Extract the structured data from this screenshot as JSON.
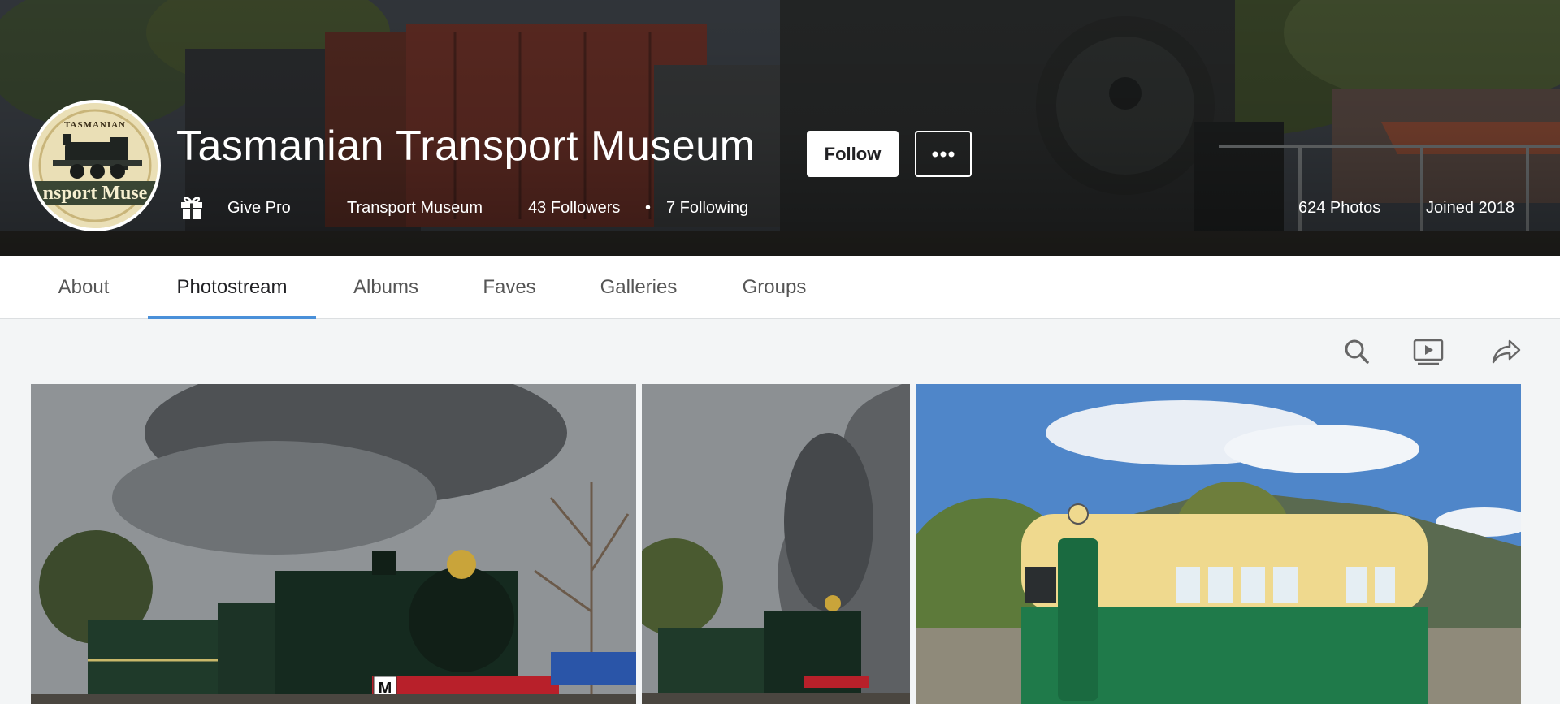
{
  "profile": {
    "name": "Tasmanian Transport Museum",
    "follow_label": "Follow",
    "give_pro_label": "Give Pro",
    "account_type": "Transport Museum",
    "followers": "43 Followers",
    "following": "7 Following",
    "photos": "624 Photos",
    "joined": "Joined 2018",
    "avatar": {
      "arc_text": "TASMANIAN",
      "banner_text": "nsport Muse"
    }
  },
  "tabs": [
    {
      "label": "About",
      "active": false
    },
    {
      "label": "Photostream",
      "active": true
    },
    {
      "label": "Albums",
      "active": false
    },
    {
      "label": "Faves",
      "active": false
    },
    {
      "label": "Galleries",
      "active": false
    },
    {
      "label": "Groups",
      "active": false
    }
  ],
  "toolbar": {
    "icons": [
      "search-icon",
      "slideshow-icon",
      "share-icon"
    ]
  },
  "photos": [
    {
      "subject": "steam-locomotive-with-carriages",
      "plate": "M"
    },
    {
      "subject": "steam-locomotive-smoke-plume"
    },
    {
      "subject": "green-cream-railcar"
    }
  ],
  "colors": {
    "accent": "#4a90d9",
    "loco_green": "#1f3a2a",
    "railcar_green": "#1f7a4a",
    "railcar_cream": "#efd98e"
  }
}
